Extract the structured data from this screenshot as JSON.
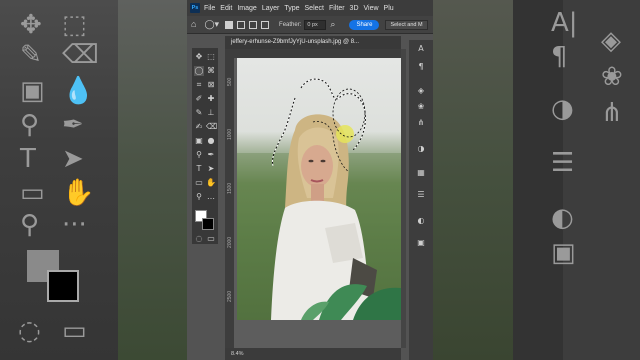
{
  "menu": {
    "logo": "Ps",
    "items": [
      "File",
      "Edit",
      "Image",
      "Layer",
      "Type",
      "Select",
      "Filter",
      "3D",
      "View",
      "Plu"
    ]
  },
  "options": {
    "feather_label": "Feather:",
    "feather_value": "0 px",
    "share_label": "Share",
    "select_mask_label": "Select and M"
  },
  "document": {
    "tab_title": "jeffery-erhunse-Z9bmfJyYjU-unsplash.jpg @ 8...",
    "ruler_marks": [
      "500",
      "1000",
      "1500",
      "2000",
      "2500"
    ],
    "zoom": "8.4%"
  },
  "icons": {
    "tools": [
      "move-icon",
      "marquee-icon",
      "lasso-icon",
      "quick-select-icon",
      "crop-icon",
      "frame-icon",
      "eyedropper-icon",
      "healing-icon",
      "brush-icon",
      "stamp-icon",
      "history-brush-icon",
      "eraser-icon",
      "gradient-icon",
      "blur-icon",
      "dodge-icon",
      "pen-icon",
      "type-icon",
      "path-select-icon",
      "rectangle-icon",
      "hand-icon",
      "zoom-icon",
      "more-icon"
    ],
    "right_panel": [
      "type-panel-icon",
      "paragraph-icon",
      "layers-icon",
      "channels-icon",
      "paths-icon",
      "adjustments-icon",
      "properties-icon",
      "sliders-icon",
      "color-icon",
      "swatches-icon"
    ]
  },
  "colors": {
    "accent": "#1473e6",
    "foreground": "#ffffff",
    "background": "#000000"
  }
}
